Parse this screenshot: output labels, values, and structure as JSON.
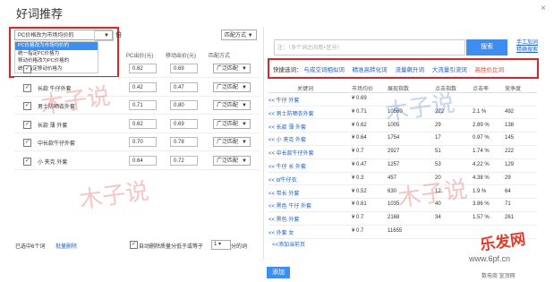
{
  "dialog": {
    "title": "好词推荐",
    "close_icon": "×"
  },
  "left": {
    "price_mode": {
      "selected": "PC价格改为市场均价的",
      "options": [
        "PC价格改为市场均价的",
        "统一指定PC价格为",
        "移动价格改为PC价格的",
        "统一指定移动价格为"
      ]
    },
    "times_value": "",
    "times_unit": "倍",
    "match_select": "匹配方式",
    "headers": {
      "pc_bid": "PC出价(元)",
      "mobile_bid": "移动出价(元)",
      "match": "匹配方式"
    },
    "rows": [
      {
        "keyword": "",
        "pc": "0.62",
        "mobile": "0.69",
        "match": "广泛匹配",
        "checked": "✓"
      },
      {
        "keyword": "长款 牛仔外套",
        "pc": "0.42",
        "mobile": "0.47",
        "match": "广泛匹配",
        "checked": "✓"
      },
      {
        "keyword": "男士防晒衣外套",
        "pc": "0.71",
        "mobile": "0.80",
        "match": "广泛匹配",
        "checked": "✓"
      },
      {
        "keyword": "长款 薄 外套",
        "pc": "0.62",
        "mobile": "0.69",
        "match": "广泛匹配",
        "checked": "✓"
      },
      {
        "keyword": "中长款牛仔外套",
        "pc": "0.70",
        "mobile": "0.78",
        "match": "广泛匹配",
        "checked": "✓"
      },
      {
        "keyword": "小 夹克 外套",
        "pc": "0.64",
        "mobile": "0.72",
        "match": "广泛匹配",
        "checked": "✓"
      }
    ],
    "footer": {
      "selected_count": "已选中6个词",
      "batch_delete": "批量删除",
      "auto_delete": "自动删除质量分低于或等于",
      "score": "1",
      "score_unit": "分的词"
    }
  },
  "right": {
    "search_placeholder": "注：（多个词之间用+区分）",
    "search_btn": "搜索",
    "link_manual": "手工加词",
    "link_precise": "精确搜索",
    "quick_label": "快捷选词：",
    "quick": [
      "与成交词相似词",
      "精准高转化词",
      "流量飙升词",
      "大流量引流词",
      "高性价比词"
    ],
    "headers": {
      "keyword": "关键词",
      "price": "市场均价",
      "impressions": "展现指数",
      "clicks": "点击指数",
      "ctr": "点击率",
      "competition": "竞争度"
    },
    "rows": [
      {
        "kw": "<< 牛仔 外套",
        "price": "¥ 0.69",
        "imp": "",
        "clk": "",
        "ctr": "",
        "comp": ""
      },
      {
        "kw": "<< 男士防晒衣外套",
        "price": "¥ 0.71",
        "imp": "10560",
        "clk": "222",
        "ctr": "2.1 %",
        "comp": "492"
      },
      {
        "kw": "<< 长款 薄 外套",
        "price": "¥ 0.62",
        "imp": "1005",
        "clk": "29",
        "ctr": "2.89 %",
        "comp": "138"
      },
      {
        "kw": "<< 小 夹克 外套",
        "price": "¥ 0.64",
        "imp": "1754",
        "clk": "17",
        "ctr": "0.97 %",
        "comp": "145"
      },
      {
        "kw": "<< 中长款牛仔外套",
        "price": "¥ 0.7",
        "imp": "2927",
        "clk": "51",
        "ctr": "1.74 %",
        "comp": "222"
      },
      {
        "kw": "<< 牛仔 长 外套",
        "price": "¥ 0.47",
        "imp": "1257",
        "clk": "53",
        "ctr": "4.22 %",
        "comp": "129"
      },
      {
        "kw": "<< bf牛仔衣",
        "price": "¥ 0.3",
        "imp": "457",
        "clk": "20",
        "ctr": "4.38 %",
        "comp": "29"
      },
      {
        "kw": "<< 带长 外套",
        "price": "¥ 0.52",
        "imp": "630",
        "clk": "12",
        "ctr": "1.9 %",
        "comp": "64"
      },
      {
        "kw": "<< 黑色 牛仔 外套",
        "price": "¥ 0.61",
        "imp": "1035",
        "clk": "40",
        "ctr": "3.86 %",
        "comp": "71"
      },
      {
        "kw": "<< 黑色 外套",
        "price": "¥ 0.7",
        "imp": "2168",
        "clk": "34",
        "ctr": "1.57 %",
        "comp": "261"
      },
      {
        "kw": "<< 外套 女",
        "price": "¥ 0.7",
        "imp": "11655",
        "clk": "",
        "ctr": "",
        "comp": ""
      }
    ],
    "add_link": "<<添加当前页",
    "add_btn": "添加"
  },
  "watermark": {
    "text": "木子说",
    "logo": "乐发网",
    "url": "www.6pf.cn",
    "sub": "数电商 宣顶网"
  }
}
